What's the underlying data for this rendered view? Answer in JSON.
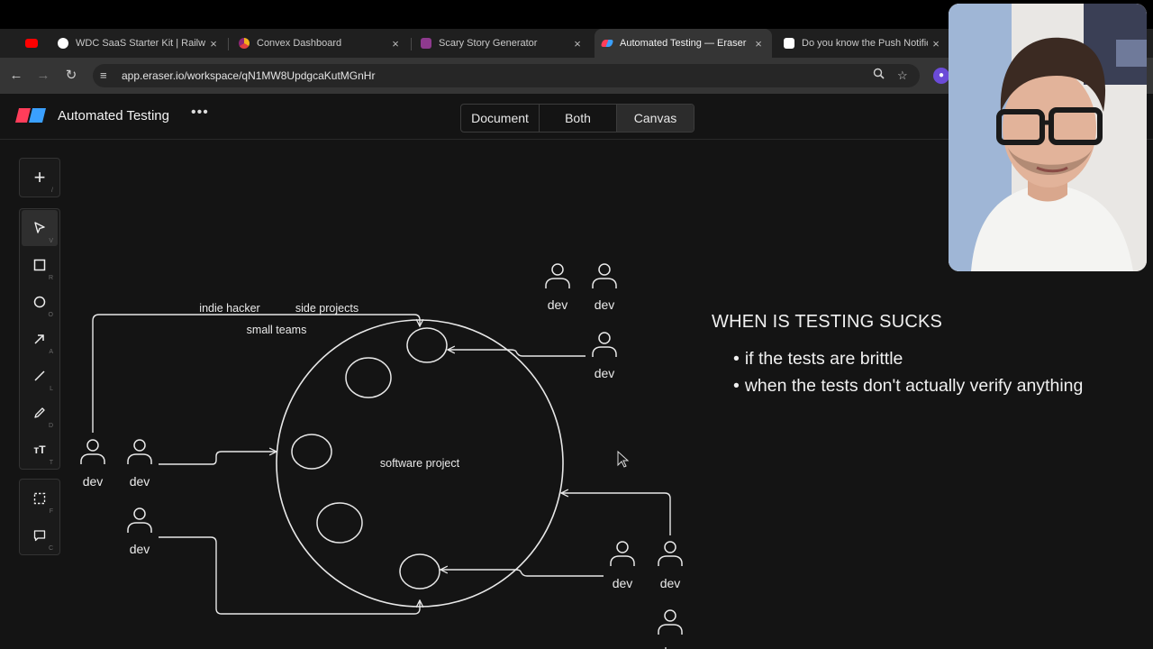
{
  "browser": {
    "tabs": [
      {
        "title": "",
        "icon": "youtube-icon",
        "color": "#ff0000"
      },
      {
        "title": "WDC SaaS Starter Kit | Railway",
        "icon": "github-icon",
        "color": "#ffffff"
      },
      {
        "title": "Convex Dashboard",
        "icon": "convex-icon",
        "color": "#f3b01c"
      },
      {
        "title": "Scary Story Generator",
        "icon": "scary-story-icon",
        "color": "#8e3a8e"
      },
      {
        "title": "Automated Testing — Eraser",
        "icon": "eraser-icon",
        "color": "#ff3d5a",
        "active": true
      },
      {
        "title": "Do you know the Push Notifications",
        "icon": "medium-icon",
        "color": "#ffffff"
      }
    ],
    "close_glyph": "×",
    "url": "app.eraser.io/workspace/qN1MW8UpdgcaKutMGnHr"
  },
  "app": {
    "title": "Automated Testing",
    "more_glyph": "•••",
    "view_modes": [
      "Document",
      "Both",
      "Canvas"
    ],
    "selected_view": "Canvas",
    "accent_colors": [
      "#ff3d5a",
      "#3aa0ff"
    ]
  },
  "toolbar": {
    "add_glyph": "+",
    "add_key": "/",
    "tools": [
      {
        "name": "select-tool",
        "icon": "cursor-icon",
        "key": "V",
        "selected": true
      },
      {
        "name": "rectangle-tool",
        "icon": "square-icon",
        "key": "R"
      },
      {
        "name": "ellipse-tool",
        "icon": "circle-icon",
        "key": "O"
      },
      {
        "name": "arrow-tool",
        "icon": "arrow-icon",
        "key": "A"
      },
      {
        "name": "line-tool",
        "icon": "line-icon",
        "key": "L"
      },
      {
        "name": "pencil-tool",
        "icon": "pencil-icon",
        "key": "D"
      },
      {
        "name": "text-tool",
        "icon": "text-icon",
        "glyph": "ᴛT",
        "key": "T"
      }
    ],
    "extra_tools": [
      {
        "name": "frame-tool",
        "icon": "frame-icon",
        "key": "F"
      },
      {
        "name": "comment-tool",
        "icon": "comment-icon",
        "key": "C"
      }
    ]
  },
  "diagram": {
    "center_label": "software project",
    "group_labels": [
      "indie hacker",
      "side projects",
      "small teams"
    ],
    "person_label": "dev"
  },
  "note": {
    "heading": "WHEN IS TESTING SUCKS",
    "bullets": [
      "if the tests are brittle",
      "when the tests don't actually verify anything"
    ]
  }
}
